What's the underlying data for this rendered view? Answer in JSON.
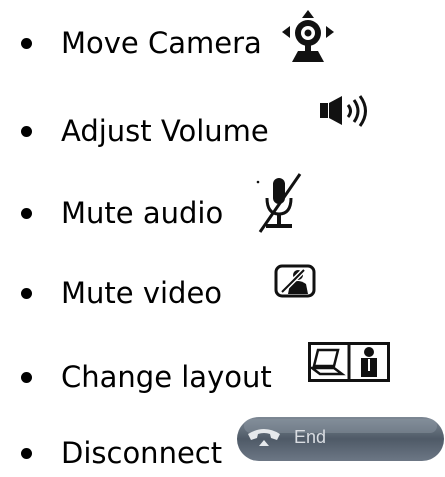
{
  "items": [
    {
      "label": "Move Camera",
      "icon": "camera-move-icon"
    },
    {
      "label": "Adjust Volume",
      "icon": "speaker-volume-icon"
    },
    {
      "label": "Mute audio",
      "icon": "microphone-muted-icon"
    },
    {
      "label": "Mute video",
      "icon": "video-muted-icon"
    },
    {
      "label": "Change layout",
      "icon": "layout-icon"
    },
    {
      "label": "Disconnect",
      "icon": "end-call-button",
      "button_text": "End"
    }
  ],
  "colors": {
    "text": "#000000",
    "end_button": "#4a5563",
    "end_button_highlight": "#6b7684"
  }
}
